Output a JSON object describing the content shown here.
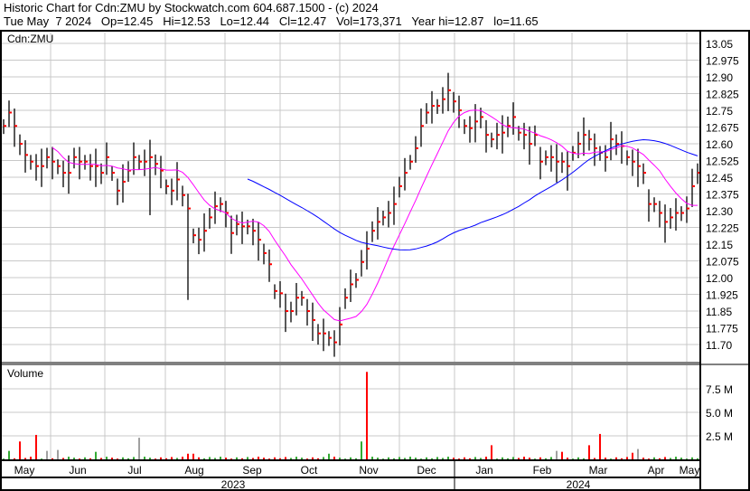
{
  "header": {
    "title": "Historic Chart for Cdn:ZMU by Stockwatch.com 604.687.1500 - (c) 2024",
    "quote": "Tue May  7 2024   Op=12.45   Hi=12.53   Lo=12.44   Cl=12.47   Vol=173,371   Year hi=12.87   lo=11.65"
  },
  "chart_data": {
    "type": "ohlc",
    "symbol": "Cdn:ZMU",
    "volume_label": "Volume",
    "price_ticks": [
      "13.05",
      "12.975",
      "12.90",
      "12.825",
      "12.75",
      "12.675",
      "12.60",
      "12.525",
      "12.45",
      "12.375",
      "12.30",
      "12.225",
      "12.15",
      "12.075",
      "12.00",
      "11.925",
      "11.85",
      "11.775",
      "11.70"
    ],
    "ylim": [
      11.65,
      13.1
    ],
    "volume_ticks": [
      "7.5 M",
      "5.0 M",
      "2.5 M"
    ],
    "volume_ylim_millions": [
      0,
      10
    ],
    "months": [
      "May",
      "Jun",
      "Jul",
      "Aug",
      "Sep",
      "Oct",
      "Nov",
      "Dec",
      "Jan",
      "Feb",
      "Mar",
      "Apr",
      "May"
    ],
    "years": [
      "2023",
      "2024"
    ],
    "closes": [
      12.68,
      12.74,
      12.68,
      12.6,
      12.55,
      12.52,
      12.5,
      12.5,
      12.54,
      12.52,
      12.5,
      12.47,
      12.47,
      12.54,
      12.52,
      12.52,
      12.5,
      12.5,
      12.47,
      12.54,
      12.47,
      12.39,
      12.43,
      12.48,
      12.54,
      12.52,
      12.52,
      12.54,
      12.51,
      12.48,
      12.41,
      12.39,
      12.44,
      12.37,
      12.31,
      12.19,
      12.17,
      12.21,
      12.27,
      12.32,
      12.33,
      12.29,
      12.2,
      12.24,
      12.23,
      12.23,
      12.21,
      12.17,
      12.11,
      12.06,
      11.94,
      11.93,
      11.85,
      11.85,
      11.91,
      11.91,
      11.85,
      11.81,
      11.75,
      11.75,
      11.73,
      11.71,
      11.79,
      11.91,
      11.97,
      11.99,
      12.07,
      12.13,
      12.21,
      12.25,
      12.27,
      12.29,
      12.33,
      12.41,
      12.47,
      12.52,
      12.58,
      12.68,
      12.74,
      12.77,
      12.77,
      12.8,
      12.84,
      12.79,
      12.75,
      12.68,
      12.67,
      12.7,
      12.72,
      12.64,
      12.62,
      12.64,
      12.65,
      12.68,
      12.72,
      12.65,
      12.64,
      12.6,
      12.64,
      12.52,
      12.54,
      12.54,
      12.52,
      12.52,
      12.5,
      12.56,
      12.6,
      12.64,
      12.62,
      12.58,
      12.56,
      12.54,
      12.62,
      12.6,
      12.59,
      12.54,
      12.52,
      12.5,
      12.47,
      12.33,
      12.33,
      12.29,
      12.25,
      12.27,
      12.29,
      12.29,
      12.31,
      12.41,
      12.47
    ],
    "long_lows": [
      [
        27,
        12.28
      ],
      [
        34,
        11.9
      ],
      [
        104,
        12.39
      ]
    ],
    "volume_default_millions": 0.2,
    "volume_notable": [
      [
        1,
        0.9,
        "up"
      ],
      [
        3,
        1.9,
        "down"
      ],
      [
        6,
        2.6,
        "down"
      ],
      [
        8,
        0.9,
        "flat"
      ],
      [
        10,
        1.0,
        "flat"
      ],
      [
        17,
        0.8,
        "up"
      ],
      [
        25,
        2.3,
        "flat"
      ],
      [
        34,
        0.6,
        "down"
      ],
      [
        35,
        0.6,
        "down"
      ],
      [
        60,
        0.6,
        "up"
      ],
      [
        66,
        1.9,
        "up"
      ],
      [
        67,
        9.3,
        "down"
      ],
      [
        90,
        1.5,
        "down"
      ],
      [
        102,
        0.9,
        "flat"
      ],
      [
        103,
        0.8,
        "down"
      ],
      [
        108,
        1.5,
        "down"
      ],
      [
        110,
        2.7,
        "down"
      ],
      [
        116,
        0.7,
        "down"
      ],
      [
        117,
        1.1,
        "flat"
      ]
    ],
    "ma_short_period": 10,
    "ma_long_period": 46,
    "colors": {
      "bar": "#000000",
      "close_tick": "#ff0000",
      "ma_short": "#ff00ff",
      "ma_long": "#0000ff",
      "up": "#33aa33",
      "down": "#ff0000",
      "flat": "#a0a0a0",
      "grid": "#c8c8c8"
    }
  }
}
